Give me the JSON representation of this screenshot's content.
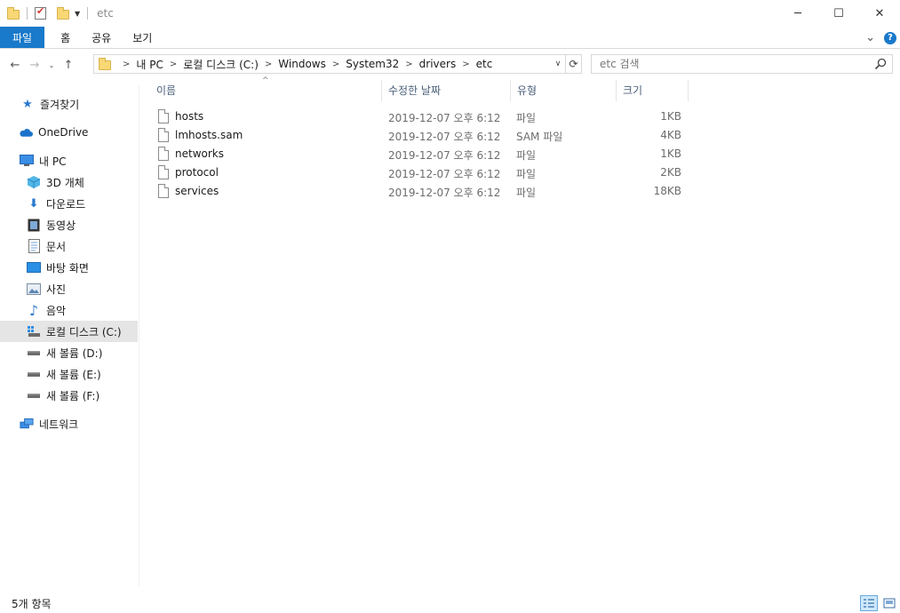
{
  "window": {
    "title": "etc",
    "controls": {
      "minimize": "─",
      "maximize": "☐",
      "close": "✕"
    }
  },
  "ribbon": {
    "tabs": [
      "파일",
      "홈",
      "공유",
      "보기"
    ],
    "collapse_glyph": "⌄",
    "help_glyph": "?"
  },
  "nav": {
    "back_glyph": "←",
    "forward_glyph": "→",
    "recent_glyph": "⌄",
    "up_glyph": "↑"
  },
  "address": {
    "breadcrumbs": [
      "내 PC",
      "로컬 디스크 (C:)",
      "Windows",
      "System32",
      "drivers",
      "etc"
    ]
  },
  "search": {
    "placeholder": "etc 검색"
  },
  "sidebar": {
    "items": [
      {
        "label": "즐겨찾기",
        "icon": "star-icon"
      },
      {
        "label": "OneDrive",
        "icon": "cloud-icon"
      },
      {
        "label": "내 PC",
        "icon": "pc-icon"
      },
      {
        "label": "3D 개체",
        "icon": "cube-icon"
      },
      {
        "label": "다운로드",
        "icon": "download-icon"
      },
      {
        "label": "동영상",
        "icon": "video-icon"
      },
      {
        "label": "문서",
        "icon": "document-icon"
      },
      {
        "label": "바탕 화면",
        "icon": "desktop-icon"
      },
      {
        "label": "사진",
        "icon": "picture-icon"
      },
      {
        "label": "음악",
        "icon": "music-icon"
      },
      {
        "label": "로컬 디스크 (C:)",
        "icon": "windows-drive-icon",
        "selected": true
      },
      {
        "label": "새 볼륨 (D:)",
        "icon": "drive-icon"
      },
      {
        "label": "새 볼륨 (E:)",
        "icon": "drive-icon"
      },
      {
        "label": "새 볼륨 (F:)",
        "icon": "drive-icon"
      },
      {
        "label": "네트워크",
        "icon": "network-icon"
      }
    ]
  },
  "file_list": {
    "columns": {
      "name": "이름",
      "modified": "수정한 날짜",
      "type": "유형",
      "size": "크기"
    },
    "sort_glyph": "^",
    "rows": [
      {
        "name": "hosts",
        "modified": "2019-12-07 오후 6:12",
        "type": "파일",
        "size": "1KB"
      },
      {
        "name": "lmhosts.sam",
        "modified": "2019-12-07 오후 6:12",
        "type": "SAM 파일",
        "size": "4KB"
      },
      {
        "name": "networks",
        "modified": "2019-12-07 오후 6:12",
        "type": "파일",
        "size": "1KB"
      },
      {
        "name": "protocol",
        "modified": "2019-12-07 오후 6:12",
        "type": "파일",
        "size": "2KB"
      },
      {
        "name": "services",
        "modified": "2019-12-07 오후 6:12",
        "type": "파일",
        "size": "18KB"
      }
    ]
  },
  "status_bar": {
    "item_count": "5개 항목"
  },
  "colors": {
    "accent": "#1979ca",
    "selected_bg": "#e5e5e5",
    "header_text": "#4c607a"
  }
}
